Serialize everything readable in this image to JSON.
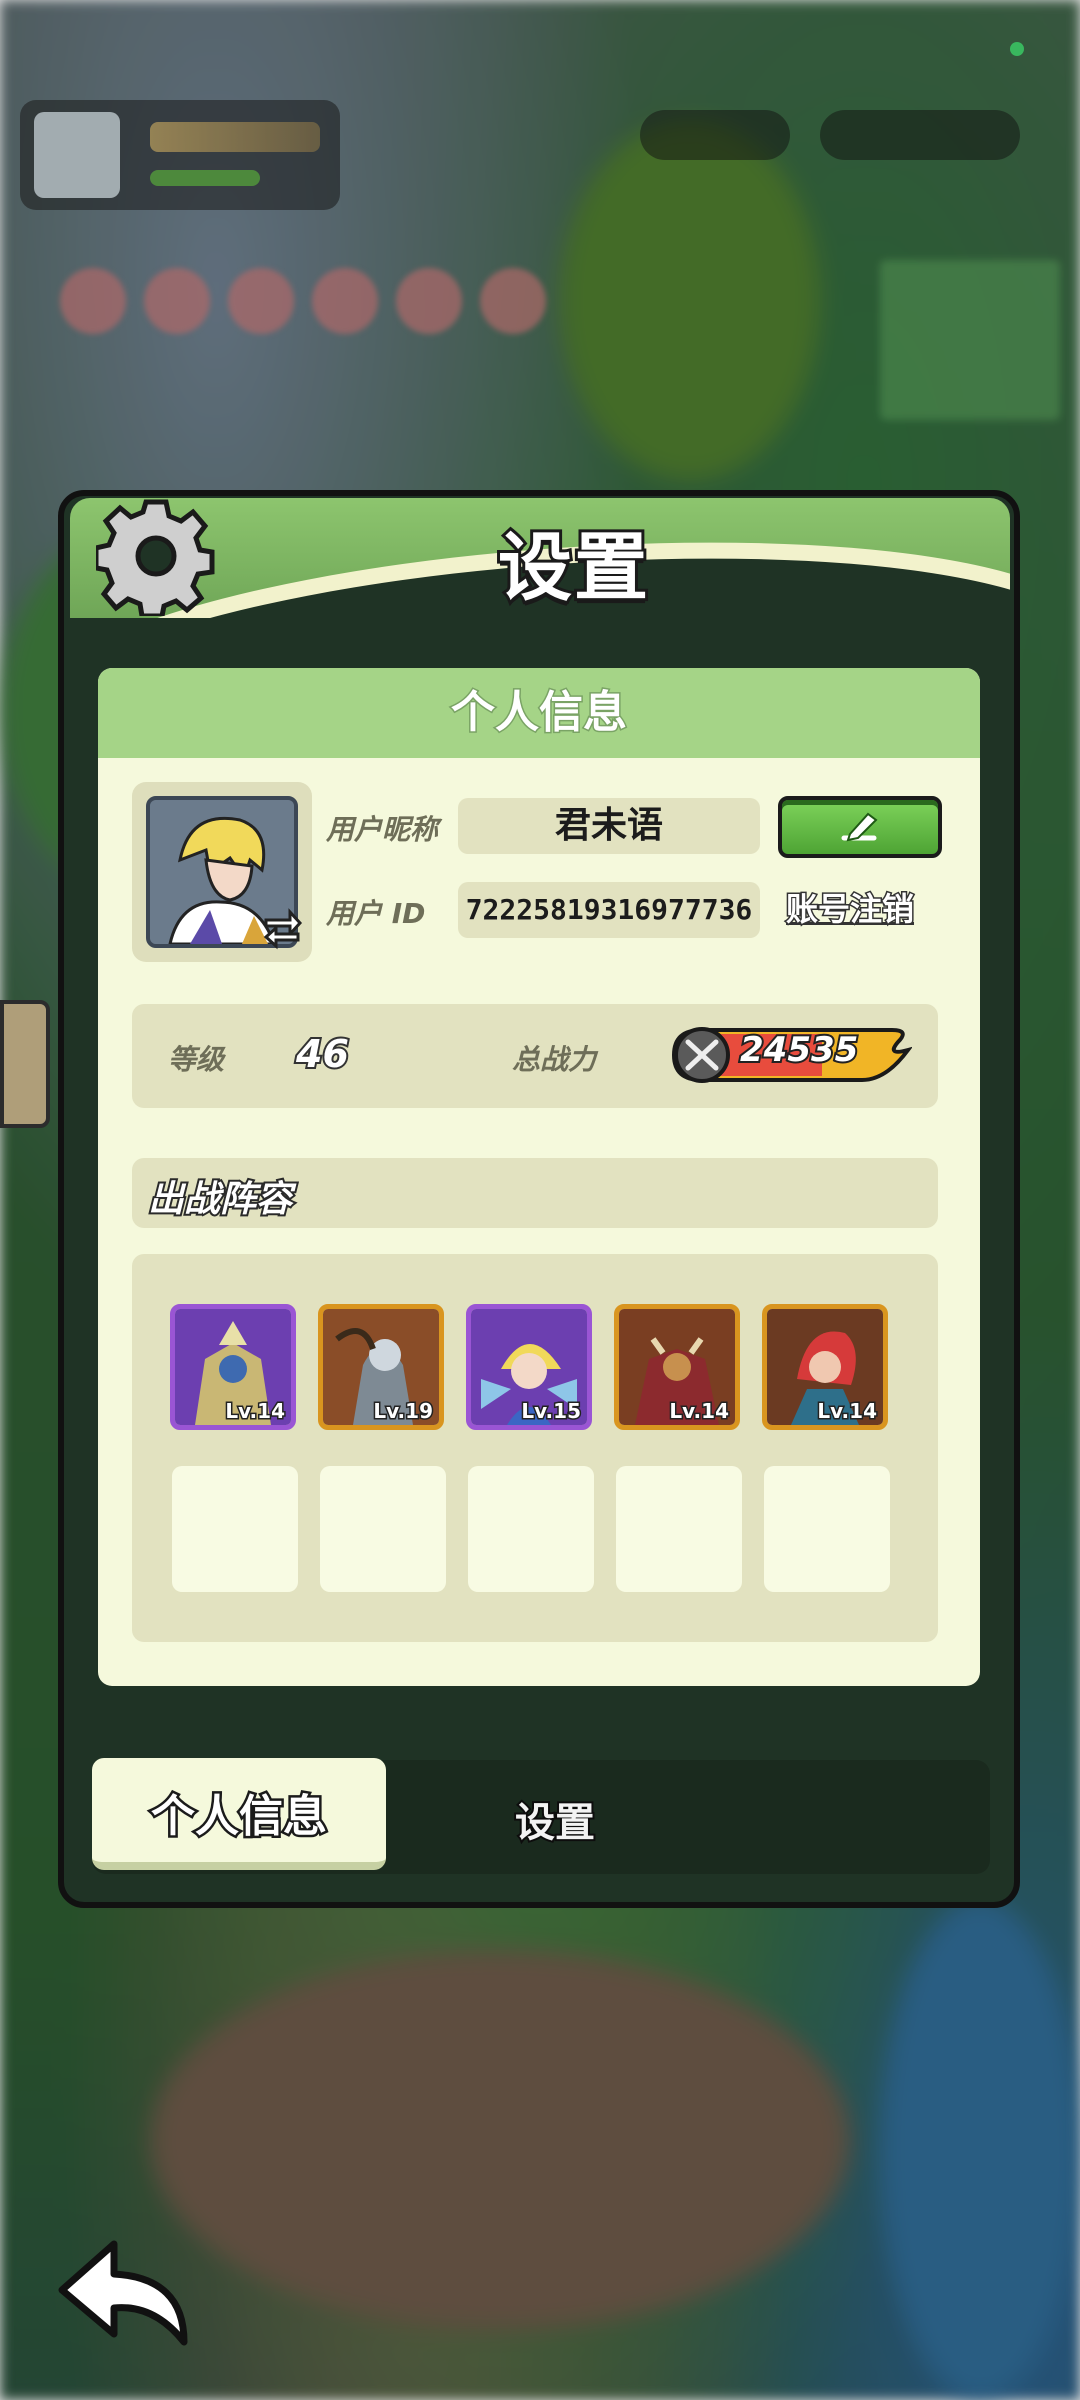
{
  "dialog": {
    "title": "设置",
    "section_title": "个人信息"
  },
  "profile": {
    "nickname_label": "用户昵称",
    "nickname": "君未语",
    "id_label": "用户 ID",
    "user_id": "72225819316977736",
    "cancel_account": "账号注销",
    "level_label": "等级",
    "level": "46",
    "power_label": "总战力",
    "power": "24535"
  },
  "lineup": {
    "title": "出战阵容",
    "heroes": [
      {
        "level": "Lv.14",
        "rarity": "purple"
      },
      {
        "level": "Lv.19",
        "rarity": "gold"
      },
      {
        "level": "Lv.15",
        "rarity": "purple"
      },
      {
        "level": "Lv.14",
        "rarity": "gold"
      },
      {
        "level": "Lv.14",
        "rarity": "gold"
      }
    ]
  },
  "tabs": {
    "active": "个人信息",
    "inactive": "设置"
  },
  "icons": {
    "settings": "gear-icon",
    "edit": "pencil-icon",
    "swap": "swap-arrows-icon",
    "power": "crossed-swords-icon",
    "back": "back-arrow-icon"
  },
  "colors": {
    "header_green": "#8dc56e",
    "card_bg": "#f5f9dc",
    "edit_button": "#5fbf3f",
    "purple_rarity": "#9a55d4",
    "gold_rarity": "#d9951f"
  }
}
